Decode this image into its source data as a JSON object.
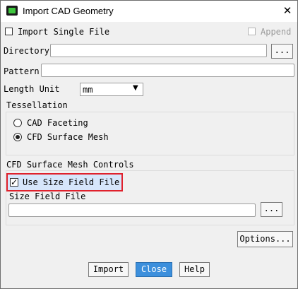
{
  "window": {
    "title": "Import CAD Geometry",
    "close_icon": "close-icon",
    "app_icon": "fluent-icon"
  },
  "import_single_file": {
    "label": "Import Single File",
    "checked": false
  },
  "append": {
    "label": "Append",
    "checked": false,
    "enabled": false
  },
  "directory": {
    "label": "Directory",
    "value": "",
    "browse_label": "..."
  },
  "pattern": {
    "label": "Pattern",
    "value": ""
  },
  "length_unit": {
    "label": "Length Unit",
    "value": "mm"
  },
  "tessellation": {
    "title": "Tessellation",
    "options": [
      {
        "label": "CAD Faceting",
        "selected": false
      },
      {
        "label": "CFD Surface Mesh",
        "selected": true
      }
    ]
  },
  "cfd_controls": {
    "title": "CFD Surface Mesh Controls",
    "use_size_field": {
      "label": "Use Size Field File",
      "checked": true
    },
    "size_field_file": {
      "label": "Size Field File",
      "value": "",
      "browse_label": "..."
    }
  },
  "options_button": "Options...",
  "footer": {
    "import": "Import",
    "close": "Close",
    "help": "Help"
  },
  "colors": {
    "highlight_border": "#e0212c",
    "primary_button": "#3c8fdc"
  }
}
